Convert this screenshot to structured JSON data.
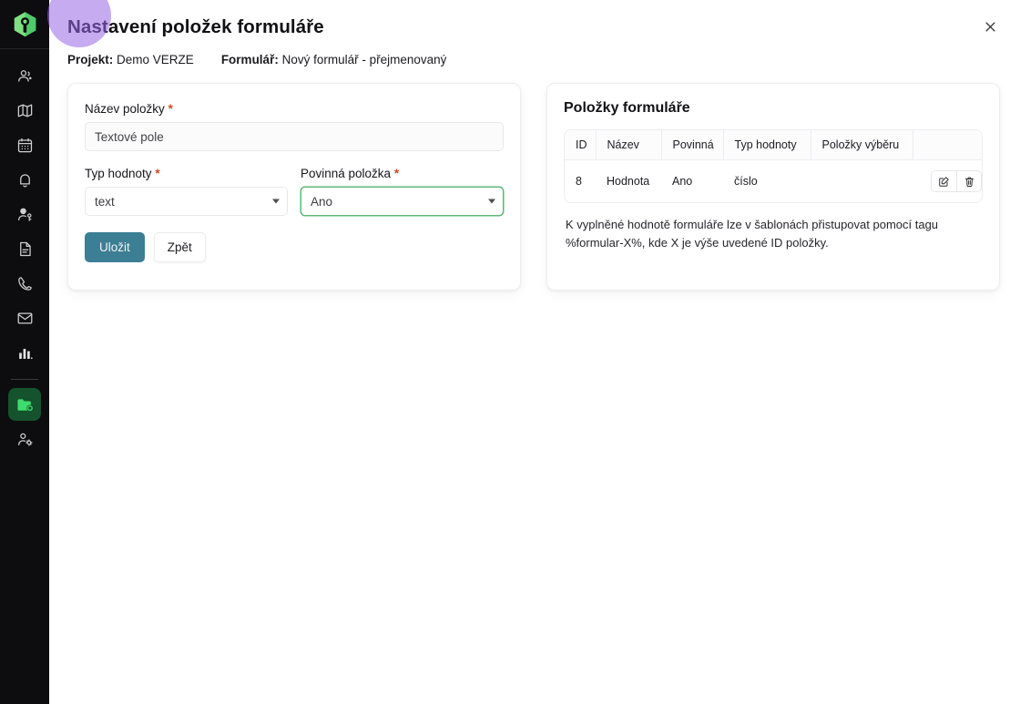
{
  "sidebar": {
    "logo": {
      "name": "app-logo",
      "color": "#7ee081"
    },
    "items": [
      {
        "icon": "contacts-icon",
        "name": "sidebar-item-contacts",
        "active": false
      },
      {
        "icon": "map-icon",
        "name": "sidebar-item-map",
        "active": false
      },
      {
        "icon": "calendar-icon",
        "name": "sidebar-item-calendar",
        "active": false
      },
      {
        "icon": "bell-icon",
        "name": "sidebar-item-notifications",
        "active": false
      },
      {
        "icon": "user-key-icon",
        "name": "sidebar-item-access",
        "active": false
      },
      {
        "icon": "document-icon",
        "name": "sidebar-item-documents",
        "active": false
      },
      {
        "icon": "phone-icon",
        "name": "sidebar-item-calls",
        "active": false
      },
      {
        "icon": "mail-icon",
        "name": "sidebar-item-mail",
        "active": false
      },
      {
        "icon": "bar-chart-icon",
        "name": "sidebar-item-reports",
        "active": false
      },
      {
        "icon": "folder-settings-icon",
        "name": "sidebar-item-projects",
        "active": true
      },
      {
        "icon": "user-settings-icon",
        "name": "sidebar-item-user-settings",
        "active": false
      }
    ],
    "active_color": "#14532d",
    "active_icon_color": "#3ddc6e"
  },
  "header": {
    "title": "Nastavení položek formuláře",
    "close_label": "✕"
  },
  "meta": {
    "project_label": "Projekt:",
    "project_value": "Demo VERZE",
    "form_label": "Formulář:",
    "form_value": "Nový formulář - přejmenovaný"
  },
  "form": {
    "name_label": "Název položky",
    "name_required": "*",
    "name_value": "Textové pole",
    "name_placeholder": "Textové pole",
    "type_label": "Typ hodnoty",
    "type_required": "*",
    "type_value": "text",
    "required_label": "Povinná položka",
    "required_required": "*",
    "required_value": "Ano",
    "save_label": "Uložit",
    "back_label": "Zpět",
    "save_color": "#3c7e93",
    "valid_border_color": "#5db877",
    "click_highlight_color": "#9966e6"
  },
  "items_panel": {
    "title": "Položky formuláře",
    "columns": [
      "ID",
      "Název",
      "Povinná",
      "Typ hodnoty",
      "Položky výběru",
      ""
    ],
    "rows": [
      {
        "id": "8",
        "nazev": "Hodnota",
        "povinna": "Ano",
        "typ_hodnoty": "číslo",
        "polozky_vyberu": "",
        "actions": [
          "edit-icon",
          "delete-icon"
        ]
      }
    ],
    "hint": "K vyplněné hodnotě formuláře lze v šablonách přistupovat pomocí tagu %formular-X%, kde X je výše uvedené ID položky."
  }
}
